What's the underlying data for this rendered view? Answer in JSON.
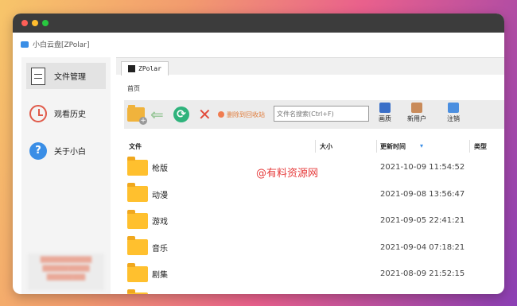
{
  "app": {
    "title": "小白云盘[ZPolar]"
  },
  "sidebar": {
    "items": [
      {
        "label": "文件管理",
        "icon": "document-icon",
        "active": true
      },
      {
        "label": "观看历史",
        "icon": "history-clock-icon",
        "active": false
      },
      {
        "label": "关于小白",
        "icon": "help-icon",
        "active": false
      }
    ]
  },
  "tab": {
    "label": "ZPolar"
  },
  "breadcrumb": "首页",
  "toolbar": {
    "recycle_label": "删除到回收站",
    "search_placeholder": "文件名搜索(Ctrl+F)",
    "quality_label": "画质",
    "new_user_label": "新用户",
    "logout_label": "注销"
  },
  "columns": {
    "file": "文件",
    "size": "大小",
    "modified": "更新时间",
    "type": "类型"
  },
  "files": [
    {
      "name": "枪版",
      "modified": "2021-10-09 11:54:52"
    },
    {
      "name": "动漫",
      "modified": "2021-09-08 13:56:47"
    },
    {
      "name": "游戏",
      "modified": "2021-09-05 22:41:21"
    },
    {
      "name": "音乐",
      "modified": "2021-09-04 07:18:21"
    },
    {
      "name": "剧集",
      "modified": "2021-08-09 21:52:15"
    },
    {
      "name": "",
      "modified": ""
    }
  ],
  "watermark": "@有料资源网",
  "colors": {
    "accent": "#3a8ee6",
    "folder": "#ffc02e",
    "delete": "#e24b3b",
    "refresh": "#2fb37c"
  }
}
